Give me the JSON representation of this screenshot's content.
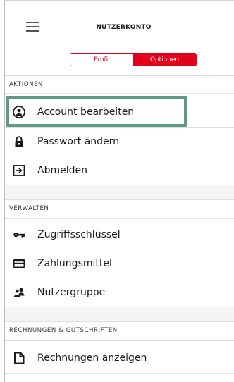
{
  "header": {
    "title": "NUTZERKONTO",
    "menu_icon": "hamburger-menu-icon"
  },
  "tabs": {
    "profile_label": "Profil",
    "options_label": "Optionen",
    "active": "Optionen",
    "accent_color": "#e2001a"
  },
  "sections": {
    "actions": {
      "label": "AKTIONEN",
      "items": [
        {
          "label": "Account bearbeiten",
          "icon": "user-circle-icon"
        },
        {
          "label": "Passwort ändern",
          "icon": "lock-icon"
        },
        {
          "label": "Abmelden",
          "icon": "logout-icon"
        }
      ]
    },
    "manage": {
      "label": "VERWALTEN",
      "items": [
        {
          "label": "Zugriffsschlüssel",
          "icon": "key-icon"
        },
        {
          "label": "Zahlungsmittel",
          "icon": "credit-card-icon"
        },
        {
          "label": "Nutzergruppe",
          "icon": "user-group-icon"
        }
      ]
    },
    "invoices": {
      "label": "RECHNUNGEN & GUTSCHRIFTEN",
      "items": [
        {
          "label": "Rechnungen anzeigen",
          "icon": "document-icon"
        }
      ]
    }
  },
  "highlight_color": "#5a9a86"
}
